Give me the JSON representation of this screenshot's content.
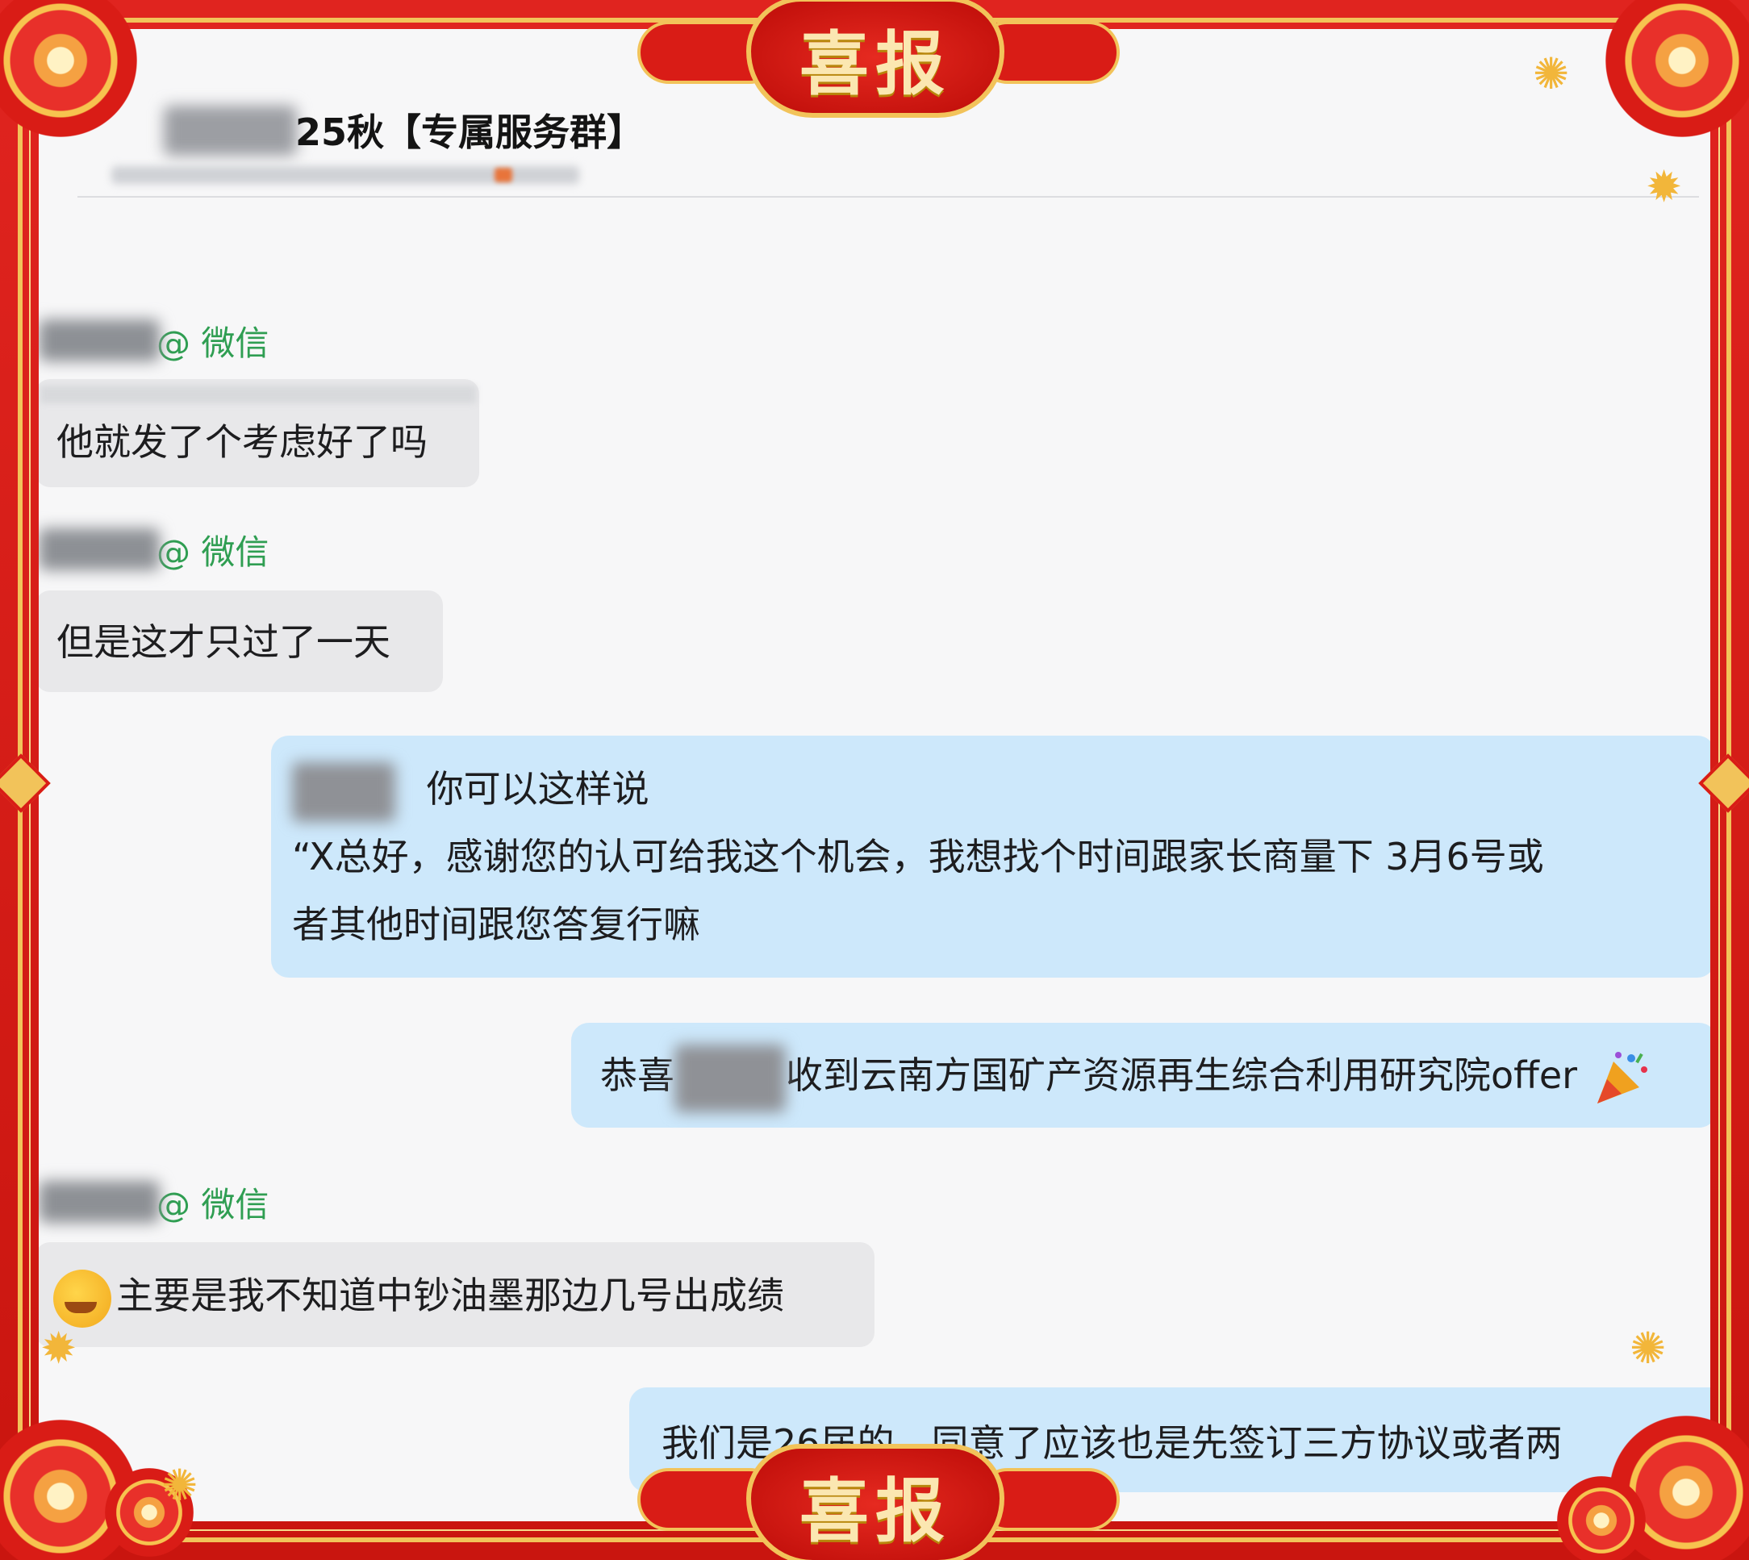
{
  "header": {
    "title": "25秋【专属服务群】"
  },
  "banners": {
    "top": "喜报",
    "bottom": "喜报"
  },
  "messages": [
    {
      "side": "left",
      "sender_tag": "@ 微信",
      "text": "他就发了个考虑好了吗"
    },
    {
      "side": "left",
      "sender_tag": "@ 微信",
      "text": "但是这才只过了一天"
    },
    {
      "side": "right",
      "line1": "你可以这样说",
      "line2": "“X总好，感谢您的认可给我这个机会，我想找个时间跟家长商量下  3月6号或",
      "line3": "者其他时间跟您答复行嘛"
    },
    {
      "side": "right",
      "prefix": "恭喜",
      "text": "收到云南方国矿产资源再生综合利用研究院offer"
    },
    {
      "side": "left",
      "sender_tag": "@ 微信",
      "text": "主要是我不知道中钞油墨那边几号出成绩"
    },
    {
      "side": "right",
      "text": "我们是26届的，同意了应该也是先签订三方协议或者两"
    }
  ],
  "icons": {
    "party": "party-popper-icon",
    "cry_laugh": "rolling-laugh-emoji-icon"
  },
  "colors": {
    "frame_red": "#d41f1c",
    "gold": "#f2c35a",
    "bubble_blue": "#cde8fb",
    "bubble_gray": "#e8e8ea",
    "wechat_green": "#2f9e52"
  }
}
